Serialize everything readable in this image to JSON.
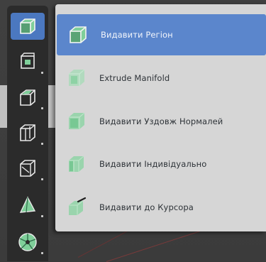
{
  "toolbar": {
    "tools": [
      {
        "icon": "extrude-region-icon",
        "active": true
      },
      {
        "icon": "inset-faces-icon",
        "active": false
      },
      {
        "icon": "bevel-icon",
        "active": false
      },
      {
        "icon": "loop-cut-icon",
        "active": false
      },
      {
        "icon": "knife-icon",
        "active": false
      },
      {
        "icon": "poly-build-icon",
        "active": false
      },
      {
        "icon": "spin-icon",
        "active": false
      }
    ]
  },
  "menu": {
    "items": [
      {
        "label": "Видавити Регіон",
        "icon": "extrude-region-icon",
        "active": true
      },
      {
        "label": "Extrude Manifold",
        "icon": "extrude-manifold-icon",
        "active": false
      },
      {
        "label": "Видавити Уздовж Нормалей",
        "icon": "extrude-along-normals-icon",
        "active": false
      },
      {
        "label": "Видавити Індивідуально",
        "icon": "extrude-individual-icon",
        "active": false
      },
      {
        "label": "Видавити до Курсора",
        "icon": "extrude-to-cursor-icon",
        "active": false
      }
    ]
  },
  "colors": {
    "accent": "#5b86cc",
    "icon_green": "#7fcf9a",
    "menu_bg": "#d6d6d6",
    "toolbar_bg": "#2b2b2b"
  }
}
